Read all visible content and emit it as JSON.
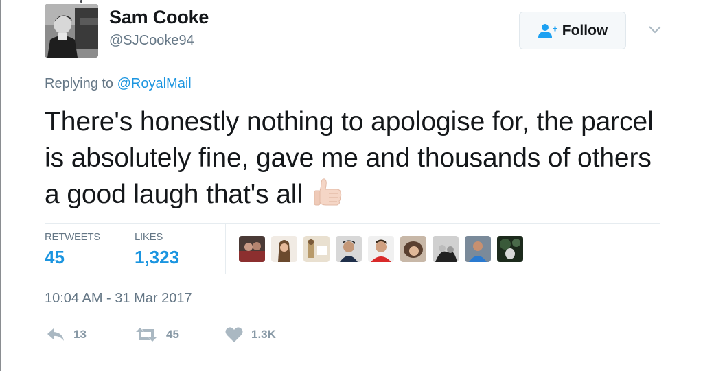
{
  "user": {
    "display_name": "Sam Cooke",
    "handle": "@SJCooke94"
  },
  "follow_button": {
    "label": "Follow",
    "icon": "follow-user-icon"
  },
  "reply": {
    "prefix": "Replying to ",
    "mention": "@RoyalMail"
  },
  "tweet": {
    "text": "There's honestly nothing to apologise for, the parcel is absolutely fine, gave me and thousands of others a good laugh that's all",
    "emoji": "thumbs-up-icon"
  },
  "stats": {
    "retweets_label": "RETWEETS",
    "retweets_value": "45",
    "likes_label": "LIKES",
    "likes_value": "1,323"
  },
  "liker_avatar_count": 9,
  "timestamp": "10:04 AM - 31 Mar 2017",
  "actions": {
    "reply_count": "13",
    "retweet_count": "45",
    "like_count": "1.3K"
  },
  "colors": {
    "link": "#1b95e0",
    "secondary_text": "#657786",
    "action_icon": "#aab8c2"
  }
}
